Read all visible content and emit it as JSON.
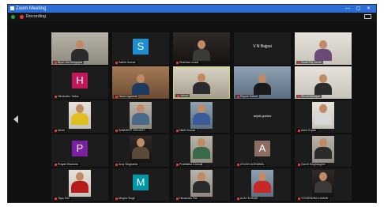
{
  "window": {
    "title": "Zoom Meeting",
    "recording_label": "Recording"
  },
  "colors": {
    "titlebar": "#2d6fd6",
    "recording": "#e53935",
    "active_border": "#c7d86a"
  },
  "tiles": [
    {
      "name": "Bipul Jha Sengupta",
      "kind": "video",
      "bg": "bg-room",
      "shirt": "#2b2b2b"
    },
    {
      "name": "Satish Kumar",
      "kind": "avatar",
      "letter": "S",
      "color": "#1b8fd1"
    },
    {
      "name": "Shahdan Imadi",
      "kind": "video",
      "bg": "bg-dark",
      "shirt": "#3a3a3a"
    },
    {
      "name": "",
      "kind": "label",
      "label": "V N Bajpai"
    },
    {
      "name": "Swati Raj Nandi",
      "kind": "video",
      "bg": "bg-light",
      "shirt": "#6b4a7a"
    },
    {
      "name": "Himanshu Yadav",
      "kind": "avatar",
      "letter": "H",
      "color": "#c2185b"
    },
    {
      "name": "Harsh Agarwal",
      "kind": "video",
      "bg": "bg-warm",
      "shirt": "#1e3a5f"
    },
    {
      "name": "Jahnvi",
      "kind": "video",
      "bg": "bg-wall",
      "shirt": "#2b2b2b",
      "active": true
    },
    {
      "name": "Piyush Garud",
      "kind": "video",
      "bg": "bg-blue",
      "shirt": "#1a1a1a"
    },
    {
      "name": "Shruti Mahajan",
      "kind": "video",
      "bg": "bg-light",
      "shirt": "#2b2b2b"
    },
    {
      "name": "Mohit",
      "kind": "photo",
      "bg": "bg-light",
      "shirt": "#e0c020"
    },
    {
      "name": "SANDEEP SRIVAST...",
      "kind": "photo",
      "bg": "bg-room",
      "shirt": "#4a6a8a"
    },
    {
      "name": "Nikhil Kumar",
      "kind": "photo",
      "bg": "bg-blue",
      "shirt": "#3a5a9a"
    },
    {
      "name": "",
      "kind": "label",
      "label": "anjali guwira",
      "small": true
    },
    {
      "name": "Akhil Gupta",
      "kind": "photo",
      "bg": "bg-light",
      "shirt": "#d8d8d8"
    },
    {
      "name": "Prayat Bhaduria",
      "kind": "avatar",
      "letter": "P",
      "color": "#7b1fa2"
    },
    {
      "name": "Anuj Singhania",
      "kind": "photo",
      "bg": "bg-dark",
      "shirt": "#5a4a3a"
    },
    {
      "name": "Prathistha Karanjit",
      "kind": "photo",
      "bg": "bg-room",
      "shirt": "#3a6a4a"
    },
    {
      "name": "AYUSH AGRAWAL",
      "kind": "avatar",
      "letter": "A",
      "color": "#8d6e63"
    },
    {
      "name": "Garvit Singhbaghel",
      "kind": "photo",
      "bg": "bg-room",
      "shirt": "#2b2b2b"
    },
    {
      "name": "Tapa Sen",
      "kind": "photo",
      "bg": "bg-light",
      "shirt": "#b71c1c"
    },
    {
      "name": "Megha Singh",
      "kind": "avatar",
      "letter": "M",
      "color": "#0097a7"
    },
    {
      "name": "Himanshu Rai",
      "kind": "photo",
      "bg": "bg-room",
      "shirt": "#2b2b2b"
    },
    {
      "name": "AJAY KUMAR",
      "kind": "photo",
      "bg": "bg-blue",
      "shirt": "#c62828"
    },
    {
      "name": "YOGENDRA KUMAR",
      "kind": "photo",
      "bg": "bg-dark",
      "shirt": "#3a3a3a"
    }
  ]
}
